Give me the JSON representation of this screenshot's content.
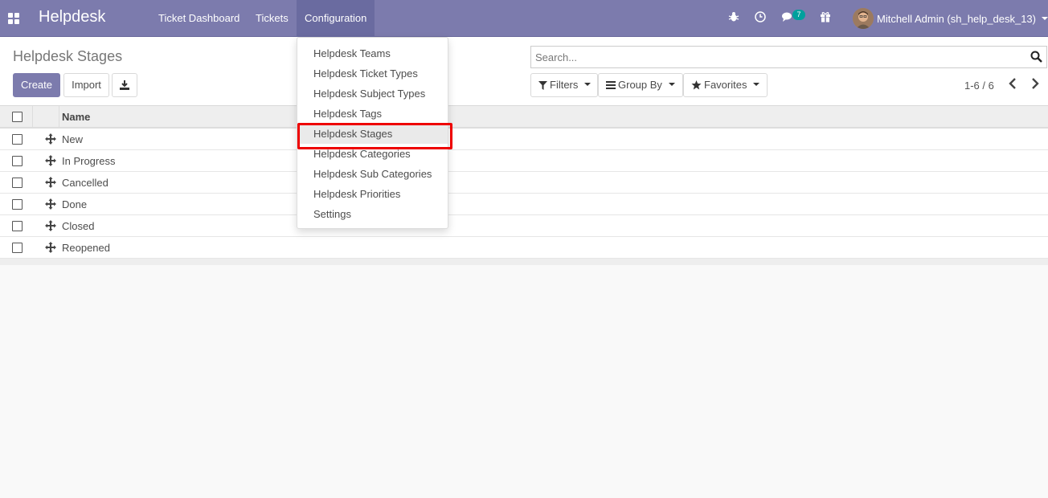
{
  "navbar": {
    "brand": "Helpdesk",
    "menus": [
      {
        "label": "Ticket Dashboard"
      },
      {
        "label": "Tickets"
      },
      {
        "label": "Configuration"
      }
    ],
    "messages_count": "7",
    "user_name": "Mitchell Admin (sh_help_desk_13)"
  },
  "control_panel": {
    "title": "Helpdesk Stages",
    "create_label": "Create",
    "import_label": "Import",
    "search_placeholder": "Search...",
    "filters_label": "Filters",
    "group_by_label": "Group By",
    "favorites_label": "Favorites",
    "pager": "1-6 / 6"
  },
  "list": {
    "columns": [
      "Name"
    ],
    "rows": [
      {
        "name": "New"
      },
      {
        "name": "In Progress"
      },
      {
        "name": "Cancelled"
      },
      {
        "name": "Done"
      },
      {
        "name": "Closed"
      },
      {
        "name": "Reopened"
      }
    ]
  },
  "configuration_menu": {
    "items": [
      {
        "label": "Helpdesk Teams"
      },
      {
        "label": "Helpdesk Ticket Types"
      },
      {
        "label": "Helpdesk Subject Types"
      },
      {
        "label": "Helpdesk Tags"
      },
      {
        "label": "Helpdesk Stages"
      },
      {
        "label": "Helpdesk Categories"
      },
      {
        "label": "Helpdesk Sub Categories"
      },
      {
        "label": "Helpdesk Priorities"
      },
      {
        "label": "Settings"
      }
    ],
    "highlighted_item": "Helpdesk Stages"
  },
  "colors": {
    "brand": "#7c7bad",
    "highlight_border": "#ee0000",
    "badge": "#00a09d"
  },
  "icons": [
    "apps-grid-icon",
    "bug-icon",
    "clock-icon",
    "chat-icon",
    "gift-icon",
    "search-icon",
    "filter-icon",
    "list-icon",
    "star-icon",
    "download-icon",
    "chevron-left-icon",
    "chevron-right-icon",
    "drag-handle-icon"
  ]
}
